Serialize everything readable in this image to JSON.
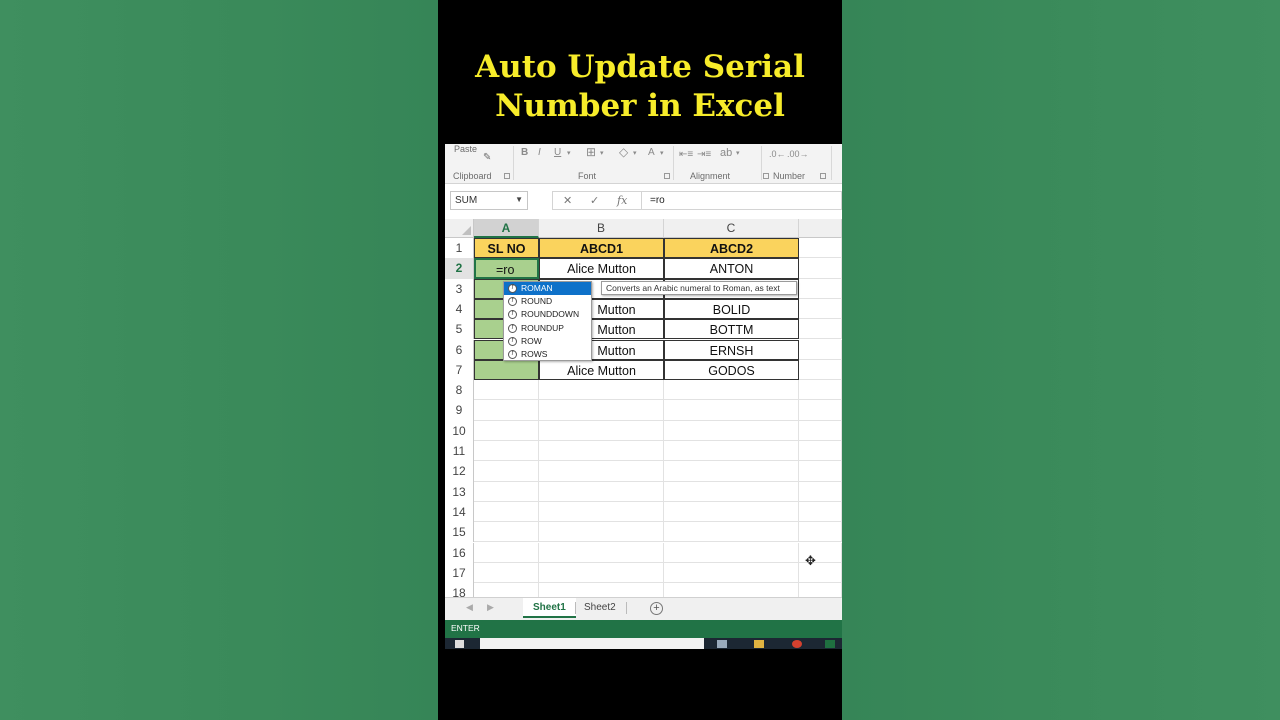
{
  "headline": {
    "line1": "Auto Update Serial",
    "line2": "Number in Excel"
  },
  "ribbon": {
    "paste_label": "Paste",
    "bold": "B",
    "italic": "I",
    "underline": "U",
    "font_color": "A",
    "groups": {
      "clipboard": "Clipboard",
      "font": "Font",
      "alignment": "Alignment",
      "number": "Number"
    }
  },
  "formula_bar": {
    "name_box": "SUM",
    "cancel": "✕",
    "enter": "✓",
    "fx": "fx",
    "value": "=ro"
  },
  "columns": [
    "A",
    "B",
    "C"
  ],
  "rows": [
    "1",
    "2",
    "3",
    "4",
    "5",
    "6",
    "7",
    "8",
    "9",
    "10",
    "11",
    "12",
    "13",
    "14",
    "15",
    "16",
    "17",
    "18"
  ],
  "table": {
    "headers": [
      "SL NO",
      "ABCD1",
      "ABCD2"
    ],
    "active_cell_text": "=ro",
    "col_b": [
      "Alice Mutton",
      "Mutton",
      "Mutton",
      "Mutton",
      "Mutton",
      "Alice Mutton"
    ],
    "col_b_row3_partial": "M",
    "col_c": [
      "ANTON",
      "",
      "BOLID",
      "BOTTM",
      "ERNSH",
      "GODOS"
    ]
  },
  "autocomplete": {
    "items": [
      "ROMAN",
      "ROUND",
      "ROUNDDOWN",
      "ROUNDUP",
      "ROW",
      "ROWS"
    ],
    "selected": "ROMAN",
    "tooltip": "Converts an Arabic numeral to Roman, as text"
  },
  "sheet_tabs": {
    "tabs": [
      "Sheet1",
      "Sheet2"
    ],
    "active": "Sheet1",
    "add": "+"
  },
  "status_bar": {
    "mode": "ENTER"
  },
  "colors": {
    "header_fill": "#fad35d",
    "serial_fill": "#a9d08e",
    "excel_green": "#217346",
    "headline_yellow": "#f7ec2a"
  }
}
